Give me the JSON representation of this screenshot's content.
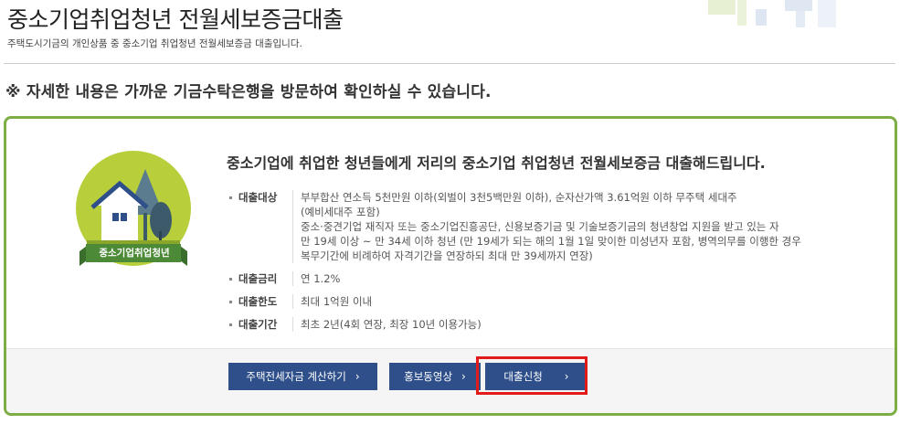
{
  "page": {
    "title": "중소기업취업청년 전월세보증금대출",
    "subtitle": "주택도시기금의 개인상품 중 중소기업 취업청년 전월세보증금 대출입니다."
  },
  "notice": "※ 자세한 내용은 가까운 기금수탁은행을 방문하여 확인하실 수 있습니다.",
  "product": {
    "badge_label": "중소기업취업청년",
    "headline": "중소기업에 취업한 청년들에게 저리의 중소기업 취업청년 전월세보증금 대출해드립니다.",
    "details": [
      {
        "label": "대출대상",
        "lines": [
          "부부합산 연소득 5천만원 이하(외벌이 3천5백만원 이하), 순자산가액 3.61억원 이하 무주택 세대주",
          "(예비세대주 포함)",
          "중소·중견기업 재직자 또는 중소기업진흥공단, 신용보증기금 및 기술보증기금의 청년창업 지원을 받고 있는 자",
          "만 19세 이상 ~ 만 34세 이하 청년 (만 19세가 되는 해의 1월 1일 맞이한 미성년자 포함, 병역의무를 이행한 경우",
          "복무기간에 비례하여 자격기간을 연장하되 최대 만 39세까지 연장)"
        ]
      },
      {
        "label": "대출금리",
        "lines": [
          "연 1.2%"
        ]
      },
      {
        "label": "대출한도",
        "lines": [
          "최대 1억원 이내"
        ]
      },
      {
        "label": "대출기간",
        "lines": [
          "최초 2년(4회 연장, 최장 10년 이용가능)"
        ]
      }
    ]
  },
  "buttons": {
    "calculator": "주택전세자금 계산하기",
    "video": "홍보동영상",
    "apply": "대출신청"
  },
  "colors": {
    "card_border": "#7cae45",
    "button_bg": "#2e4f8a",
    "highlight": "#e21a1a",
    "logo_circle": "#b8cf3b"
  },
  "icons": {
    "chevron": "chevron-right-icon",
    "logo": "house-tree-logo"
  }
}
